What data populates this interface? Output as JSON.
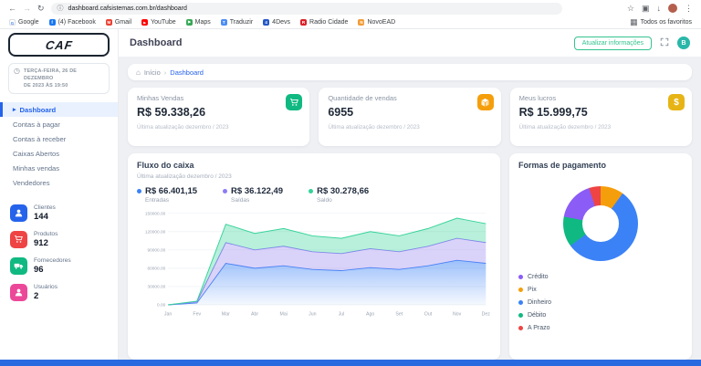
{
  "colors": {
    "accent_blue": "#2563eb",
    "success_green": "#34c38f",
    "bottom_bar": "#2a6ae0"
  },
  "icons": {
    "back": "←",
    "forward": "→",
    "reload": "↻",
    "info": "ⓘ",
    "star": "☆",
    "panel": "▣",
    "download": "↓",
    "menu": "⋮",
    "folder": "▦",
    "clock": "◷",
    "chevron": "▸",
    "home": "⌂",
    "sep": "›"
  },
  "browser": {
    "url": "dashboard.cafsistemas.com.br/dashboard",
    "profile_color": "#b45f4d",
    "bookmarks": [
      {
        "label": "Google"
      },
      {
        "label": "(4) Facebook"
      },
      {
        "label": "Gmail"
      },
      {
        "label": "YouTube"
      },
      {
        "label": "Maps"
      },
      {
        "label": "Traduzir"
      },
      {
        "label": "4Devs"
      },
      {
        "label": "Radio Cidade"
      },
      {
        "label": "NovoEAD"
      }
    ],
    "all_favorites": "Todos os favoritos"
  },
  "logo": {
    "text": "CAF"
  },
  "header": {
    "title": "Dashboard",
    "update_button": "Atualizar informações",
    "avatar_initial": "B",
    "avatar_color": "#2ab7a9"
  },
  "sidebar": {
    "datetime_line1": "TERÇA-FEIRA, 26 DE DEZEMBRO",
    "datetime_line2": "DE 2023 ÀS 19:50",
    "menu": [
      {
        "label": "Dashboard",
        "active": true
      },
      {
        "label": "Contas à pagar",
        "active": false
      },
      {
        "label": "Contas à receber",
        "active": false
      },
      {
        "label": "Caixas Abertos",
        "active": false
      },
      {
        "label": "Minhas vendas",
        "active": false
      },
      {
        "label": "Vendedores",
        "active": false
      }
    ],
    "stats": [
      {
        "label": "Clientes",
        "value": "144",
        "color": "#2563eb"
      },
      {
        "label": "Produtos",
        "value": "912",
        "color": "#ef4444"
      },
      {
        "label": "Fornecedores",
        "value": "96",
        "color": "#10b981"
      },
      {
        "label": "Usuários",
        "value": "2",
        "color": "#ec4899"
      }
    ]
  },
  "breadcrumb": {
    "home": "Início",
    "current": "Dashboard"
  },
  "summary_cards": [
    {
      "title": "Minhas Vendas",
      "value": "R$ 59.338,26",
      "footer": "Última atualização dezembro / 2023",
      "icon": "cart-icon",
      "icon_color": "#10b981"
    },
    {
      "title": "Quantidade de vendas",
      "value": "6955",
      "footer": "Última atualização dezembro / 2023",
      "icon": "box-icon",
      "icon_color": "#f59e0b"
    },
    {
      "title": "Meus lucros",
      "value": "R$ 15.999,75",
      "footer": "Última atualização dezembro / 2023",
      "icon": "money-icon",
      "icon_color": "#e7b416"
    }
  ],
  "chart_data": [
    {
      "type": "area",
      "title": "Fluxo do caixa",
      "subtitle": "Última atualização dezembro / 2023",
      "categories": [
        "Jan",
        "Fev",
        "Mar",
        "Abr",
        "Mai",
        "Jun",
        "Jul",
        "Ago",
        "Set",
        "Out",
        "Nov",
        "Dez"
      ],
      "stacked": true,
      "grid": true,
      "ylim": [
        0,
        150000
      ],
      "yticks": [
        "150000.00",
        "120000.00",
        "90000.00",
        "60000.00",
        "30000.00",
        "0.00"
      ],
      "series": [
        {
          "name": "Entradas",
          "total": "R$ 66.401,15",
          "color": "#3b82f6",
          "values": [
            0,
            3000,
            68000,
            60000,
            64000,
            58000,
            56000,
            61000,
            58000,
            64000,
            73000,
            68000
          ]
        },
        {
          "name": "Saídas",
          "total": "R$ 36.122,49",
          "color": "#8b7cf6",
          "values": [
            0,
            2000,
            34000,
            30000,
            32000,
            29000,
            28000,
            31000,
            29000,
            32000,
            36000,
            34000
          ]
        },
        {
          "name": "Saldo",
          "total": "R$ 30.278,66",
          "color": "#34d399",
          "values": [
            0,
            1000,
            30000,
            27000,
            29000,
            26000,
            25000,
            28000,
            26000,
            29000,
            33000,
            31000
          ]
        }
      ]
    },
    {
      "type": "pie",
      "donut": true,
      "title": "Formas de pagamento",
      "legend_position": "bottom",
      "segment_order": [
        1,
        2,
        3,
        0,
        4
      ],
      "slices": [
        {
          "label": "Crédito",
          "color": "#8b5cf6",
          "value": 17
        },
        {
          "label": "Pix",
          "color": "#f59e0b",
          "value": 10
        },
        {
          "label": "Dinheiro",
          "color": "#3b82f6",
          "value": 55
        },
        {
          "label": "Débito",
          "color": "#10b981",
          "value": 13
        },
        {
          "label": "A Prazo",
          "color": "#ef4444",
          "value": 5
        }
      ]
    }
  ]
}
